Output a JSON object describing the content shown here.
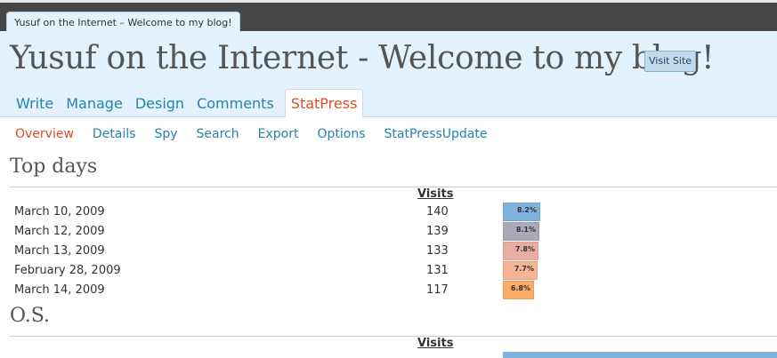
{
  "window": {
    "tab_title": "Yusuf on the Internet – Welcome to my blog!"
  },
  "header": {
    "site_title": "Yusuf on the Internet - Welcome to my blog!",
    "visit_site_label": "Visit Site",
    "menu": [
      "Write",
      "Manage",
      "Design",
      "Comments",
      "StatPress"
    ]
  },
  "submenu": [
    "Overview",
    "Details",
    "Spy",
    "Search",
    "Export",
    "Options",
    "StatPressUpdate"
  ],
  "top_days": {
    "title": "Top days",
    "column_header": "Visits",
    "rows": [
      {
        "date": "March 10, 2009",
        "visits": "140",
        "percent": "8.2%",
        "color": "#7fb2dc"
      },
      {
        "date": "March 12, 2009",
        "visits": "139",
        "percent": "8.1%",
        "color": "#a9a9b8"
      },
      {
        "date": "March 13, 2009",
        "visits": "133",
        "percent": "7.8%",
        "color": "#e8aea3"
      },
      {
        "date": "February 28, 2009",
        "visits": "131",
        "percent": "7.7%",
        "color": "#f7b394"
      },
      {
        "date": "March 14, 2009",
        "visits": "117",
        "percent": "6.8%",
        "color": "#fcab69"
      }
    ]
  },
  "os": {
    "title": "O.S.",
    "column_header": "Visits",
    "first_row_color": "#7fb2dc"
  },
  "colors": {
    "link": "#2583ad",
    "active": "#d54e21",
    "header_bg": "#e4f2fd",
    "topbar": "#464646"
  }
}
